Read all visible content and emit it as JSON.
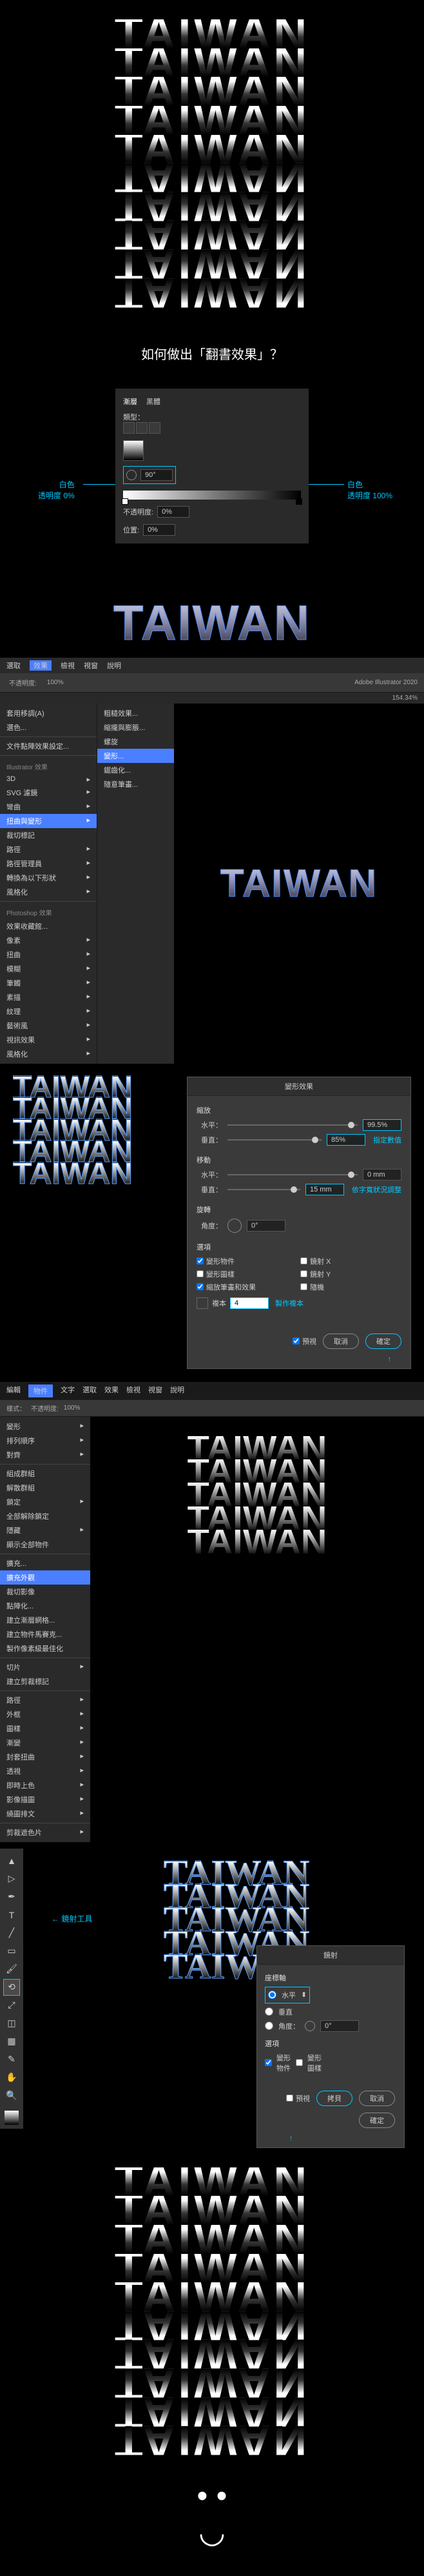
{
  "hero_text": "TAIWAN",
  "question": "如何做出「翻書效果」？",
  "gradient_panel": {
    "tab1": "漸層",
    "tab2": "黑體",
    "type_label": "類型：",
    "angle_value": "90°",
    "opacity_label": "不透明度:",
    "opacity_value": "0%",
    "position_label": "位置:",
    "position_value": "0%"
  },
  "annot_left_1": "白色",
  "annot_left_2": "透明度 0%",
  "annot_right_1": "白色",
  "annot_right_2": "透明度 100%",
  "outlined": "TAIWAN",
  "ai": {
    "menu": [
      "選取",
      "效果",
      "檢視",
      "視窗",
      "說明"
    ],
    "toolbar_opacity_label": "不透明度:",
    "toolbar_opacity": "100%",
    "app_name": "Adobe Illustrator 2020",
    "zoom": "154.34%",
    "effect_top1": "套用移調(A)",
    "effect_top2": "選色...",
    "effect_top3": "文件點陣效果設定...",
    "section_ai": "Illustrator 效果",
    "items_ai": [
      "3D",
      "SVG 濾鏡",
      "彎曲",
      "扭曲與變形",
      "裁切標記",
      "路徑",
      "路徑管理員",
      "轉換為以下形狀",
      "風格化"
    ],
    "section_ps": "Photoshop 效果",
    "items_ps": [
      "效果收藏館...",
      "像素",
      "扭曲",
      "模糊",
      "筆觸",
      "素描",
      "紋理",
      "藝術風",
      "視訊效果",
      "風格化"
    ],
    "submenu": [
      "粗糙效果...",
      "縮攏與膨脹...",
      "螺旋",
      "變形...",
      "鋸齒化...",
      "隨意筆畫..."
    ],
    "canvas_text": "TAIWAN"
  },
  "transform": {
    "title": "變形效果",
    "scale_label": "縮放",
    "h_label": "水平：",
    "v_label": "垂直：",
    "h_val": "99.5%",
    "v_val": "85%",
    "scale_annot": "指定數值",
    "move_label": "移動",
    "mh_val": "0 mm",
    "mv_val": "15 mm",
    "move_annot": "依字寬狀況調整",
    "rotate_label": "旋轉",
    "angle_label": "角度：",
    "angle_val": "0°",
    "options_label": "選項",
    "opt1": "變形物件",
    "opt2": "鏡射 X",
    "opt3": "變形圖樣",
    "opt4": "鏡射 Y",
    "opt5": "縮放筆畫和效果",
    "opt6": "隨機",
    "copies_label": "複本",
    "copies_val": "4",
    "copies_annot": "製作複本",
    "preview": "預視",
    "cancel": "取消",
    "ok": "確定"
  },
  "obj": {
    "menubar": [
      "編輯",
      "物件",
      "文字",
      "選取",
      "效果",
      "檢視",
      "視窗",
      "說明"
    ],
    "toolbar_style": "樣式：",
    "toolbar_opacity_label": "不透明度:",
    "toolbar_opacity": "100%",
    "items": [
      "變形",
      "排列順序",
      "對齊",
      "組成群組",
      "解散群組",
      "鎖定",
      "全部解除鎖定",
      "隱藏",
      "顯示全部物件",
      "擴充...",
      "擴充外觀",
      "裁切影像",
      "點陣化...",
      "建立漸層網格...",
      "建立物件馬賽克...",
      "製作像素級最佳化",
      "切片",
      "建立剪裁標記",
      "路徑",
      "外框",
      "圖樣",
      "漸變",
      "封套扭曲",
      "透視",
      "即時上色",
      "影像描圖",
      "繞圖排文",
      "剪裁遮色片"
    ]
  },
  "step5": {
    "tool_annot": "鏡射工具",
    "dialog_title": "鏡射",
    "axis_label": "座標軸",
    "axis_h": "水平",
    "axis_v": "垂直",
    "angle_label": "角度：",
    "angle_val": "0°",
    "options_label": "選項",
    "opt_obj": "變形物件",
    "opt_pat": "變形圖樣",
    "preview": "預視",
    "copy": "拷貝",
    "cancel": "取消",
    "ok": "確定"
  },
  "smile": "◡"
}
